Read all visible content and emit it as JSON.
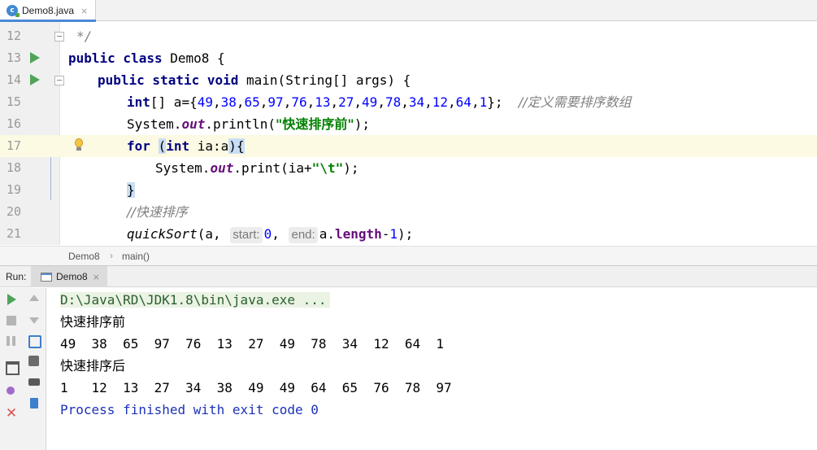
{
  "tab": {
    "label": "Demo8.java",
    "close": "×",
    "icon": "java-class-icon"
  },
  "editor": {
    "line_numbers": [
      "12",
      "13",
      "14",
      "15",
      "16",
      "17",
      "18",
      "19",
      "20",
      "21"
    ],
    "current_line": "17",
    "code": {
      "l12": "*/",
      "l13": {
        "kw": "public class",
        "text": " Demo8 {"
      },
      "l14": {
        "kw": "public static void",
        "text": " main(String[] args) {"
      },
      "l15": {
        "kw": "int",
        "pre": "[] a={",
        "nums": [
          "49",
          "38",
          "65",
          "97",
          "76",
          "13",
          "27",
          "49",
          "78",
          "34",
          "12",
          "64",
          "1"
        ],
        "post": "};",
        "comment": "//定义需要排序数组"
      },
      "l16": {
        "obj": "System.",
        "field": "out",
        "call": ".println(",
        "str": "\"快速排序前\"",
        "end": ");"
      },
      "l17": {
        "kw": "for",
        "open": "(",
        "kw2": "int",
        "body": " ia:a",
        "close": ")",
        "brace": "{"
      },
      "l18": {
        "obj": "System.",
        "field": "out",
        "call": ".print(ia+",
        "str": "\"\\t\"",
        "end": ");"
      },
      "l19": "}",
      "l20": "//快速排序",
      "l21": {
        "method": "quickSort",
        "a1": "(a, ",
        "hint1": "start:",
        "v1": "0",
        "sep": ", ",
        "hint2": "end:",
        "v2": "a.",
        "field": "length",
        "minus": "-",
        "one": "1",
        "end": ");"
      }
    }
  },
  "breadcrumb": {
    "class_name": "Demo8",
    "separator": "›",
    "method": "main()"
  },
  "run": {
    "title": "Run:",
    "tab_label": "Demo8",
    "tab_close": "×",
    "toolbar_icons": [
      "rerun-icon",
      "stop-icon",
      "pause-icon",
      "restore-layout-icon",
      "pin-icon",
      "close-icon",
      "up-stack-icon",
      "down-stack-icon",
      "soft-wrap-icon",
      "scroll-to-end-icon",
      "print-icon",
      "clear-all-icon"
    ],
    "console": {
      "command": "D:\\Java\\RD\\JDK1.8\\bin\\java.exe ...",
      "label_before": "快速排序前",
      "before": "49  38  65  97  76  13  27  49  78  34  12  64  1",
      "label_after": "快速排序后",
      "after": "1   12  13  27  34  38  49  49  64  65  76  78  97",
      "exit": "Process finished with exit code 0"
    }
  },
  "colors": {
    "keyword": "#000080",
    "number": "#0000ff",
    "string": "#008000",
    "comment": "#808080",
    "field": "#660e7a",
    "current_line": "#fcfae3",
    "run_green": "#4fa45a",
    "exit_blue": "#1c32b8"
  }
}
